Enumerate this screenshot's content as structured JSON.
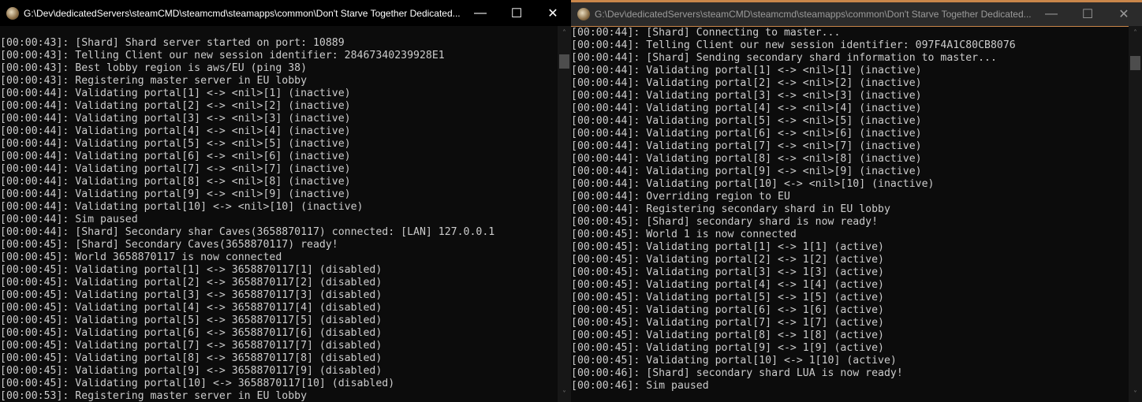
{
  "left_window": {
    "title": "G:\\Dev\\dedicatedServers\\steamCMD\\steamcmd\\steamapps\\common\\Don't Starve Together Dedicated...",
    "lines": [
      "[00:00:43]: [Shard] Shard server started on port: 10889",
      "[00:00:43]: Telling Client our new session identifier: 28467340239928E1",
      "[00:00:43]: Best lobby region is aws/EU (ping 38)",
      "[00:00:43]: Registering master server in EU lobby",
      "[00:00:44]: Validating portal[1] <-> <nil>[1] (inactive)",
      "[00:00:44]: Validating portal[2] <-> <nil>[2] (inactive)",
      "[00:00:44]: Validating portal[3] <-> <nil>[3] (inactive)",
      "[00:00:44]: Validating portal[4] <-> <nil>[4] (inactive)",
      "[00:00:44]: Validating portal[5] <-> <nil>[5] (inactive)",
      "[00:00:44]: Validating portal[6] <-> <nil>[6] (inactive)",
      "[00:00:44]: Validating portal[7] <-> <nil>[7] (inactive)",
      "[00:00:44]: Validating portal[8] <-> <nil>[8] (inactive)",
      "[00:00:44]: Validating portal[9] <-> <nil>[9] (inactive)",
      "[00:00:44]: Validating portal[10] <-> <nil>[10] (inactive)",
      "[00:00:44]: Sim paused",
      "[00:00:44]: [Shard] Secondary shar Caves(3658870117) connected: [LAN] 127.0.0.1",
      "[00:00:45]: [Shard] Secondary Caves(3658870117) ready!",
      "[00:00:45]: World 3658870117 is now connected",
      "[00:00:45]: Validating portal[1] <-> 3658870117[1] (disabled)",
      "[00:00:45]: Validating portal[2] <-> 3658870117[2] (disabled)",
      "[00:00:45]: Validating portal[3] <-> 3658870117[3] (disabled)",
      "[00:00:45]: Validating portal[4] <-> 3658870117[4] (disabled)",
      "[00:00:45]: Validating portal[5] <-> 3658870117[5] (disabled)",
      "[00:00:45]: Validating portal[6] <-> 3658870117[6] (disabled)",
      "[00:00:45]: Validating portal[7] <-> 3658870117[7] (disabled)",
      "[00:00:45]: Validating portal[8] <-> 3658870117[8] (disabled)",
      "[00:00:45]: Validating portal[9] <-> 3658870117[9] (disabled)",
      "[00:00:45]: Validating portal[10] <-> 3658870117[10] (disabled)",
      "[00:00:53]: Registering master server in EU lobby"
    ]
  },
  "right_window": {
    "title": "G:\\Dev\\dedicatedServers\\steamCMD\\steamcmd\\steamapps\\common\\Don't Starve Together Dedicated...",
    "lines": [
      "[00:00:44]: [Shard] Connecting to master...",
      "[00:00:44]: Telling Client our new session identifier: 097F4A1C80CB8076",
      "[00:00:44]: [Shard] Sending secondary shard information to master...",
      "[00:00:44]: Validating portal[1] <-> <nil>[1] (inactive)",
      "[00:00:44]: Validating portal[2] <-> <nil>[2] (inactive)",
      "[00:00:44]: Validating portal[3] <-> <nil>[3] (inactive)",
      "[00:00:44]: Validating portal[4] <-> <nil>[4] (inactive)",
      "[00:00:44]: Validating portal[5] <-> <nil>[5] (inactive)",
      "[00:00:44]: Validating portal[6] <-> <nil>[6] (inactive)",
      "[00:00:44]: Validating portal[7] <-> <nil>[7] (inactive)",
      "[00:00:44]: Validating portal[8] <-> <nil>[8] (inactive)",
      "[00:00:44]: Validating portal[9] <-> <nil>[9] (inactive)",
      "[00:00:44]: Validating portal[10] <-> <nil>[10] (inactive)",
      "[00:00:44]: Overriding region to EU",
      "[00:00:44]: Registering secondary shard in EU lobby",
      "[00:00:45]: [Shard] secondary shard is now ready!",
      "[00:00:45]: World 1 is now connected",
      "[00:00:45]: Validating portal[1] <-> 1[1] (active)",
      "[00:00:45]: Validating portal[2] <-> 1[2] (active)",
      "[00:00:45]: Validating portal[3] <-> 1[3] (active)",
      "[00:00:45]: Validating portal[4] <-> 1[4] (active)",
      "[00:00:45]: Validating portal[5] <-> 1[5] (active)",
      "[00:00:45]: Validating portal[6] <-> 1[6] (active)",
      "[00:00:45]: Validating portal[7] <-> 1[7] (active)",
      "[00:00:45]: Validating portal[8] <-> 1[8] (active)",
      "[00:00:45]: Validating portal[9] <-> 1[9] (active)",
      "[00:00:45]: Validating portal[10] <-> 1[10] (active)",
      "[00:00:46]: [Shard] secondary shard LUA is now ready!",
      "[00:00:46]: Sim paused"
    ]
  },
  "controls": {
    "minimize": "—",
    "maximize": "☐",
    "close": "✕",
    "scroll_up": "˄",
    "scroll_down": "˅"
  }
}
